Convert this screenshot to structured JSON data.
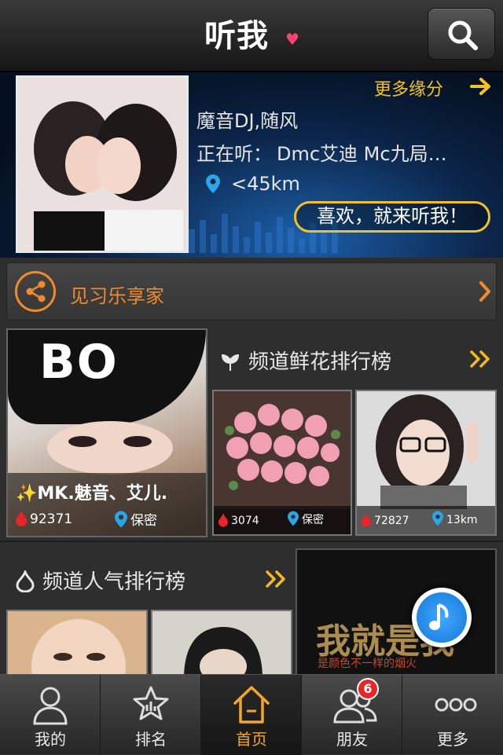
{
  "header": {
    "logo_text": "听我",
    "logo_mark": "♥",
    "search_icon": "search-icon"
  },
  "banner": {
    "more_label": "更多缘分",
    "dj_name": "魔音DJ,随风",
    "now_playing_label": "正在听：",
    "now_playing_track": "Dmc艾迪 Mc九局…",
    "distance": "<45km",
    "slogan": "喜欢，就来听我！"
  },
  "share": {
    "label": "见习乐享家"
  },
  "featured_user": {
    "cap_text": "BO",
    "name": "✨MK.魅音、艾儿.",
    "flowers": "92371",
    "location": "保密"
  },
  "flower_ranking": {
    "title": "频道鲜花排行榜",
    "items": [
      {
        "flowers": "3074",
        "location": "保密"
      },
      {
        "flowers": "72827",
        "location": "13km"
      }
    ]
  },
  "popularity_ranking": {
    "title": "频道人气排行榜"
  },
  "promo": {
    "text": "我就是我",
    "subtext": "是颜色不一样的烟火"
  },
  "tabbar": {
    "tabs": [
      {
        "label": "我的",
        "icon": "person-icon"
      },
      {
        "label": "排名",
        "icon": "star-icon"
      },
      {
        "label": "首页",
        "icon": "home-icon"
      },
      {
        "label": "朋友",
        "icon": "friends-icon",
        "badge": "6"
      },
      {
        "label": "更多",
        "icon": "more-icon"
      }
    ],
    "active": "首页"
  },
  "colors": {
    "accent_orange": "#f08a2a",
    "accent_gold": "#f5c21e",
    "badge_red": "#e8262a"
  }
}
